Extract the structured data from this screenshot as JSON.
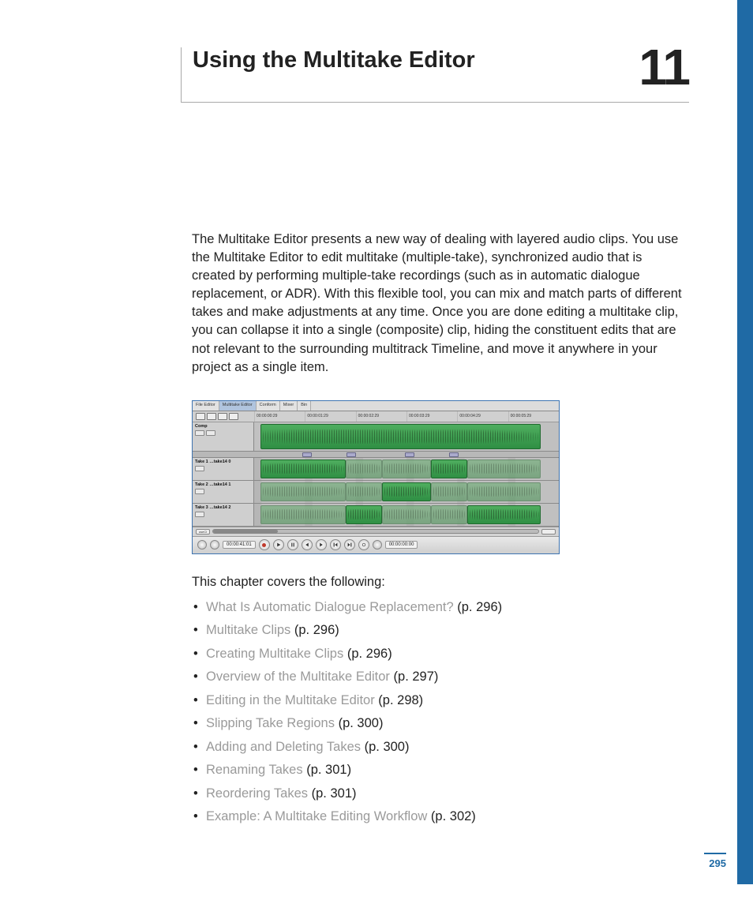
{
  "chapter": {
    "title": "Using the Multitake Editor",
    "number": "11"
  },
  "intro": "The Multitake Editor presents a new way of dealing with layered audio clips. You use the Multitake Editor to edit multitake (multiple-take), synchronized audio that is created by performing multiple-take recordings (such as in automatic dialogue replacement, or ADR). With this flexible tool, you can mix and match parts of different takes and make adjustments at any time. Once you are done editing a multitake clip, you can collapse it into a single (composite) clip, hiding the constituent edits that are not relevant to the surrounding multitrack Timeline, and move it anywhere in your project as a single item.",
  "screenshot": {
    "tabs": [
      "File Editor",
      "Multitake Editor",
      "Conform",
      "Mixer",
      "Bin"
    ],
    "ruler": [
      "00:00:00:29",
      "00:00:01:29",
      "00:00:02:29",
      "00:00:03:29",
      "00:00:04:29",
      "00:00:05:29"
    ],
    "tracks": {
      "comp": "Comp",
      "t1": "Take 1  …take14 0",
      "t2": "Take 2  …take14 1",
      "t3": "Take 3  …take14 2"
    },
    "scrollLabel": "useCl",
    "transport": {
      "tc1": "00:00:41:01",
      "tc2": "00:00:00:00"
    }
  },
  "coversLabel": "This chapter covers the following:",
  "toc": [
    {
      "t": "What Is Automatic Dialogue Replacement?",
      "p": "(p. 296)"
    },
    {
      "t": "Multitake Clips",
      "p": "(p. 296)"
    },
    {
      "t": "Creating Multitake Clips",
      "p": "(p. 296)"
    },
    {
      "t": "Overview of the Multitake Editor",
      "p": "(p. 297)"
    },
    {
      "t": "Editing in the Multitake Editor",
      "p": "(p. 298)"
    },
    {
      "t": "Slipping Take Regions",
      "p": "(p. 300)"
    },
    {
      "t": "Adding and Deleting Takes",
      "p": "(p. 300)"
    },
    {
      "t": "Renaming Takes",
      "p": "(p. 301)"
    },
    {
      "t": "Reordering Takes",
      "p": "(p. 301)"
    },
    {
      "t": "Example: A Multitake Editing Workflow",
      "p": "(p. 302)"
    }
  ],
  "pageNumber": "295"
}
